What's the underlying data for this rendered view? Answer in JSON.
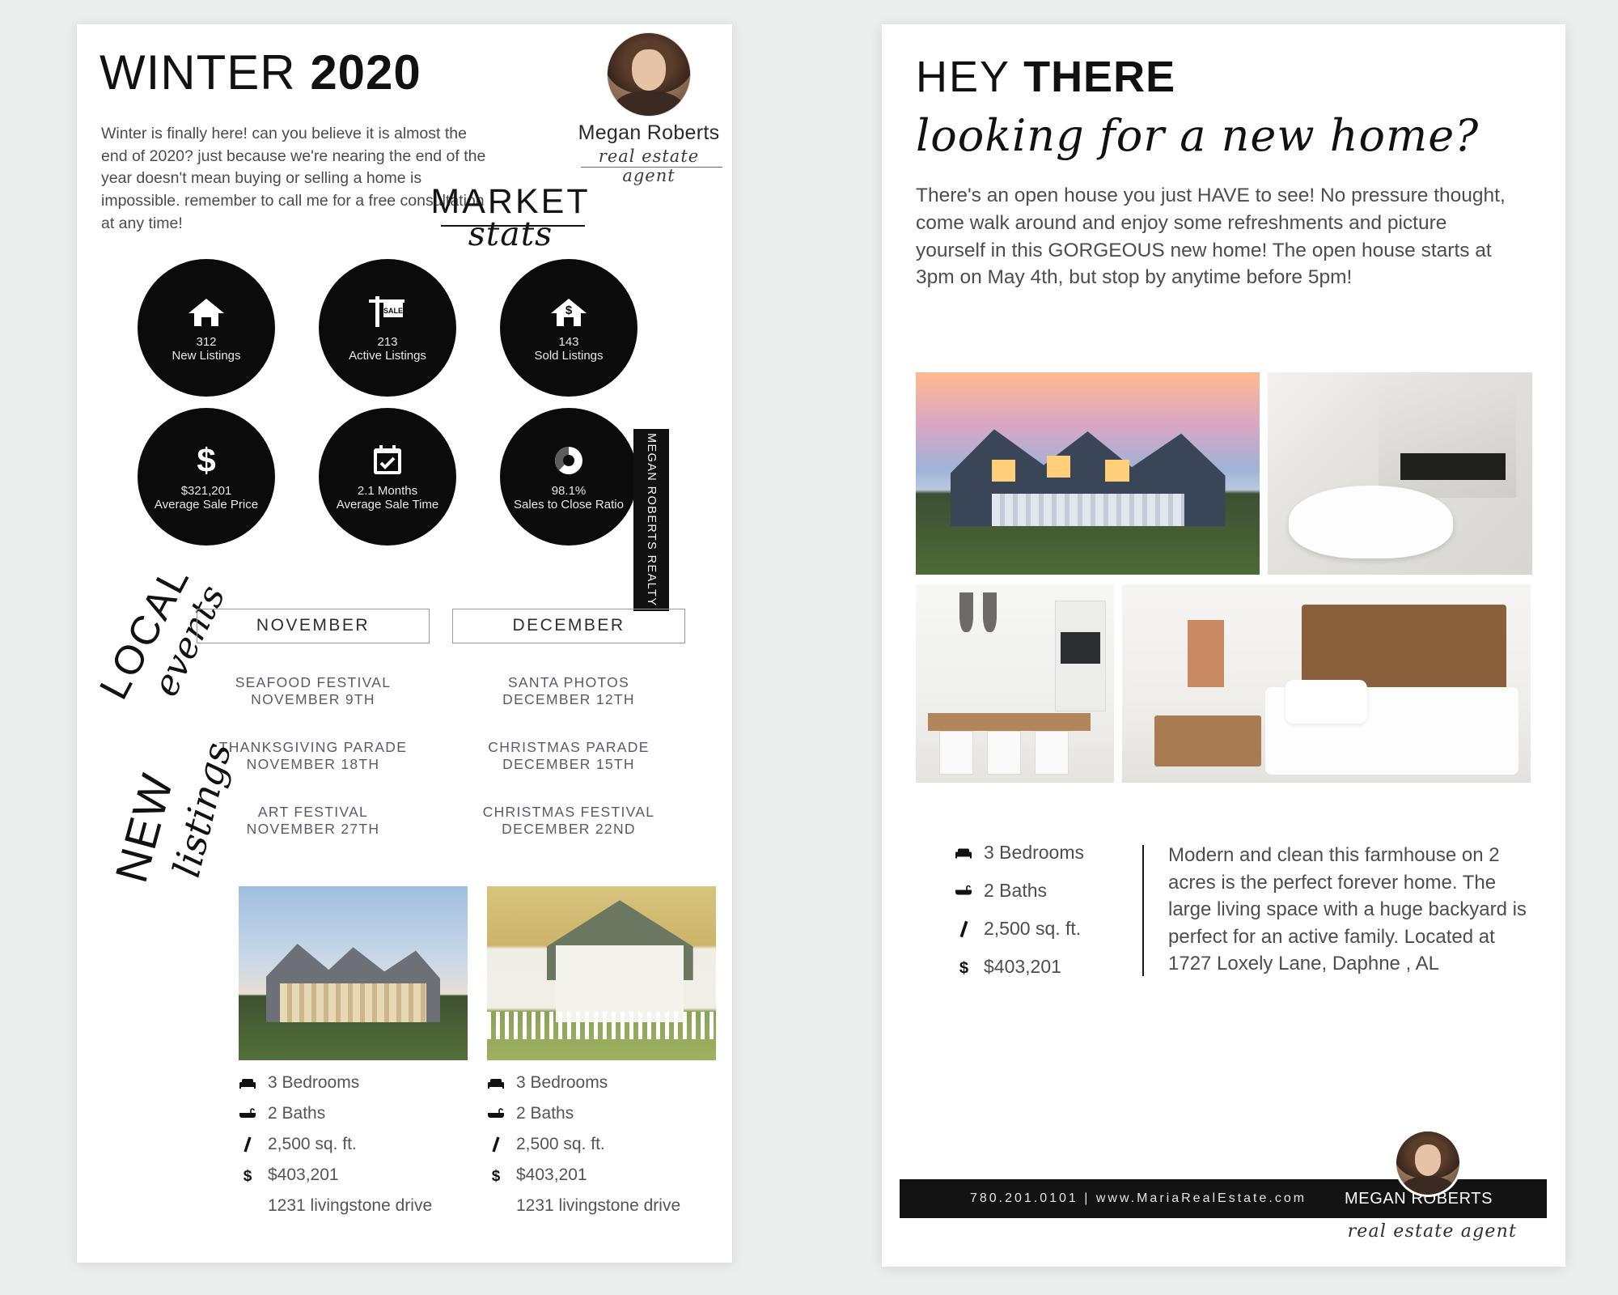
{
  "left_page": {
    "season_label": "WINTER",
    "year": "2020",
    "intro": "Winter is finally here! can you believe it is almost the end of 2020? just because we're nearing the end of the year doesn't mean buying or selling a home is impossible. remember to call me for a free consultation at any time!",
    "agent": {
      "name": "Megan Roberts",
      "role": "real estate agent",
      "avatar_icon": "agent-portrait"
    },
    "market_stats": {
      "title_word": "MARKET",
      "script_word": "stats",
      "items": [
        {
          "icon": "house-icon",
          "value": "312",
          "label": "New Listings"
        },
        {
          "icon": "for-sale-sign-icon",
          "value": "213",
          "label": "Active Listings"
        },
        {
          "icon": "house-dollar-icon",
          "value": "143",
          "label": "Sold Listings"
        },
        {
          "icon": "dollar-icon",
          "value": "$321,201",
          "label": "Average Sale Price"
        },
        {
          "icon": "calendar-check-icon",
          "value": "2.1 Months",
          "label": "Average Sale Time"
        },
        {
          "icon": "donut-chart-icon",
          "value": "98.1%",
          "label": "Sales to Close Ratio"
        }
      ]
    },
    "realty_tab": "MEGAN ROBERTS REALTY",
    "local_events": {
      "title_word": "LOCAL",
      "script_word": "events",
      "columns": [
        {
          "month": "NOVEMBER",
          "events": [
            {
              "name": "SEAFOOD FESTIVAL",
              "date": "NOVEMBER 9TH"
            },
            {
              "name": "THANKSGIVING PARADE",
              "date": "NOVEMBER 18TH"
            },
            {
              "name": "ART FESTIVAL",
              "date": "NOVEMBER 27TH"
            }
          ]
        },
        {
          "month": "DECEMBER",
          "events": [
            {
              "name": "SANTA PHOTOS",
              "date": "DECEMBER 12TH"
            },
            {
              "name": "CHRISTMAS PARADE",
              "date": "DECEMBER 15TH"
            },
            {
              "name": "CHRISTMAS FESTIVAL",
              "date": "DECEMBER 22ND"
            }
          ]
        }
      ]
    },
    "new_listings": {
      "title_word": "NEW",
      "script_word": "listings",
      "cards": [
        {
          "photo_icon": "house-exterior-photo",
          "bedrooms": "3 Bedrooms",
          "baths": "2 Baths",
          "sqft": "2,500 sq. ft.",
          "price": "$403,201",
          "address": "1231 livingstone drive"
        },
        {
          "photo_icon": "cottage-exterior-photo",
          "bedrooms": "3 Bedrooms",
          "baths": "2 Baths",
          "sqft": "2,500 sq. ft.",
          "price": "$403,201",
          "address": "1231 livingstone drive"
        }
      ]
    }
  },
  "right_page": {
    "greeting_light": "HEY",
    "greeting_bold": "THERE",
    "script_line": "looking for a new home?",
    "body": "There's an open house you just HAVE to see! No pressure thought, come walk around and enjoy some refreshments and picture yourself in this GORGEOUS new home! The open house starts at 3pm on May 4th,  but stop by anytime before 5pm!",
    "photos": [
      {
        "icon": "home-exterior-photo"
      },
      {
        "icon": "bathroom-photo"
      },
      {
        "icon": "kitchen-photo"
      },
      {
        "icon": "bedroom-photo"
      }
    ],
    "specs": {
      "bedrooms": "3 Bedrooms",
      "baths": "2 Baths",
      "sqft": "2,500 sq. ft.",
      "price": "$403,201"
    },
    "description": "Modern and clean this farmhouse on 2 acres is the perfect forever home. The large living space with a huge backyard is perfect for an active family. Located at 1727 Loxely Lane, Daphne , AL",
    "footer": {
      "contact": "780.201.0101  |  www.MariaRealEstate.com",
      "brand": "MEGAN ROBERTS",
      "role": "real estate agent",
      "avatar_icon": "agent-portrait"
    }
  },
  "colors": {
    "ink": "#111111",
    "body_text": "#4d4d4d",
    "circle_fill": "#0b0b0b",
    "page_bg": "#ffffff",
    "canvas_bg": "#eceded"
  }
}
